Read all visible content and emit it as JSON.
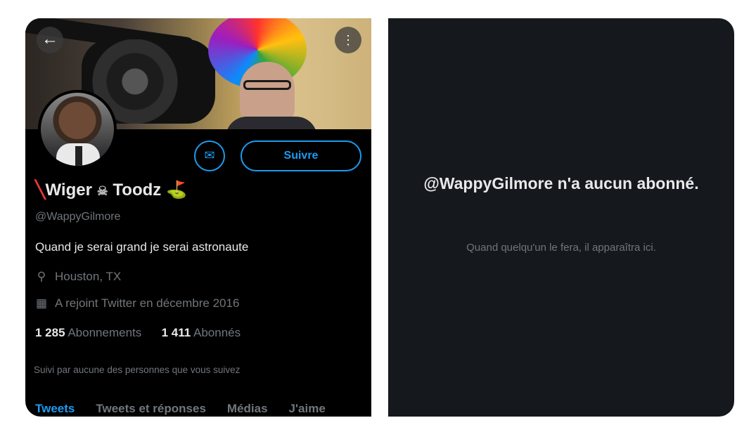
{
  "profile": {
    "display_name_prefix": "Wiger",
    "display_name_suffix": "Toodz",
    "handle": "@WappyGilmore",
    "bio": "Quand je serai grand je serai astronaute",
    "location": "Houston, TX",
    "joined": "A rejoint Twitter en décembre 2016",
    "following_count": "1 285",
    "following_label": "Abonnements",
    "followers_count": "1 411",
    "followers_label": "Abonnés",
    "followed_by": "Suivi par aucune des personnes que vous suivez",
    "follow_button": "Suivre"
  },
  "tabs": [
    "Tweets",
    "Tweets et réponses",
    "Médias",
    "J'aime"
  ],
  "empty_state": {
    "title": "@WappyGilmore n'a aucun abonné.",
    "subtitle": "Quand quelqu'un le fera, il apparaîtra ici."
  },
  "colors": {
    "accent": "#1d9bf0",
    "left_bg": "#000000",
    "right_bg": "#15181c",
    "muted_text": "#71767b"
  },
  "icons": {
    "back": "arrow-left-icon",
    "more": "more-vertical-icon",
    "mail": "envelope-icon",
    "location": "location-pin-icon",
    "calendar": "calendar-icon"
  }
}
